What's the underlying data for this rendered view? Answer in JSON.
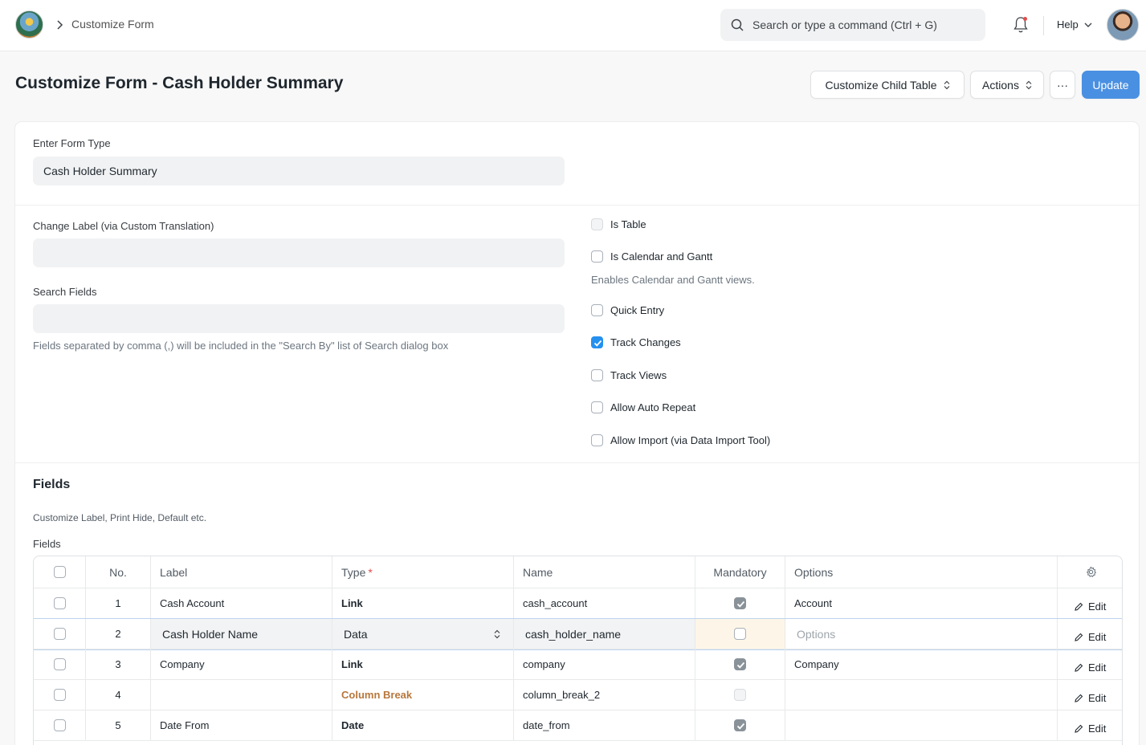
{
  "navbar": {
    "breadcrumb": "Customize Form",
    "search_placeholder": "Search or type a command (Ctrl + G)",
    "help_label": "Help"
  },
  "page": {
    "title": "Customize Form - Cash Holder Summary",
    "buttons": {
      "customize_child_table": "Customize Child Table",
      "actions": "Actions",
      "more": "···",
      "update": "Update"
    }
  },
  "form": {
    "form_type_label": "Enter Form Type",
    "form_type_value": "Cash Holder Summary",
    "change_label_label": "Change Label (via Custom Translation)",
    "change_label_value": "",
    "search_fields_label": "Search Fields",
    "search_fields_value": "",
    "search_fields_desc": "Fields separated by comma (,) will be included in the \"Search By\" list of Search dialog box",
    "checkboxes": [
      {
        "label": "Is Table",
        "checked": false,
        "disabled": true
      },
      {
        "label": "Is Calendar and Gantt",
        "checked": false,
        "disabled": false
      },
      {
        "label": "Quick Entry",
        "checked": false,
        "disabled": false
      },
      {
        "label": "Track Changes",
        "checked": true,
        "disabled": false
      },
      {
        "label": "Track Views",
        "checked": false,
        "disabled": false
      },
      {
        "label": "Allow Auto Repeat",
        "checked": false,
        "disabled": false
      },
      {
        "label": "Allow Import (via Data Import Tool)",
        "checked": false,
        "disabled": false
      }
    ],
    "calendar_desc": "Enables Calendar and Gantt views."
  },
  "fields_section": {
    "title": "Fields",
    "desc": "Customize Label, Print Hide, Default etc.",
    "grid_label": "Fields",
    "columns": {
      "no": "No.",
      "label": "Label",
      "type": "Type",
      "type_required": "*",
      "name": "Name",
      "mandatory": "Mandatory",
      "options": "Options"
    },
    "edit_label": "Edit",
    "rows": [
      {
        "no": "1",
        "label": "Cash Account",
        "type": "Link",
        "name": "cash_account",
        "mandatory": true,
        "options": "Account"
      },
      {
        "no": "2",
        "label": "Cash Holder Name",
        "type": "Data",
        "name": "cash_holder_name",
        "mandatory": false,
        "options": "",
        "options_placeholder": "Options"
      },
      {
        "no": "3",
        "label": "Company",
        "type": "Link",
        "name": "company",
        "mandatory": true,
        "options": "Company"
      },
      {
        "no": "4",
        "label": "",
        "type": "Column Break",
        "name": "column_break_2",
        "mandatory": false,
        "options": ""
      },
      {
        "no": "5",
        "label": "Date From",
        "type": "Date",
        "name": "date_from",
        "mandatory": true,
        "options": ""
      }
    ]
  },
  "colors": {
    "primary": "#4a90e2",
    "checkbox_on": "#2490ef",
    "column_break": "#b7773c",
    "required": "#e24c4c"
  }
}
